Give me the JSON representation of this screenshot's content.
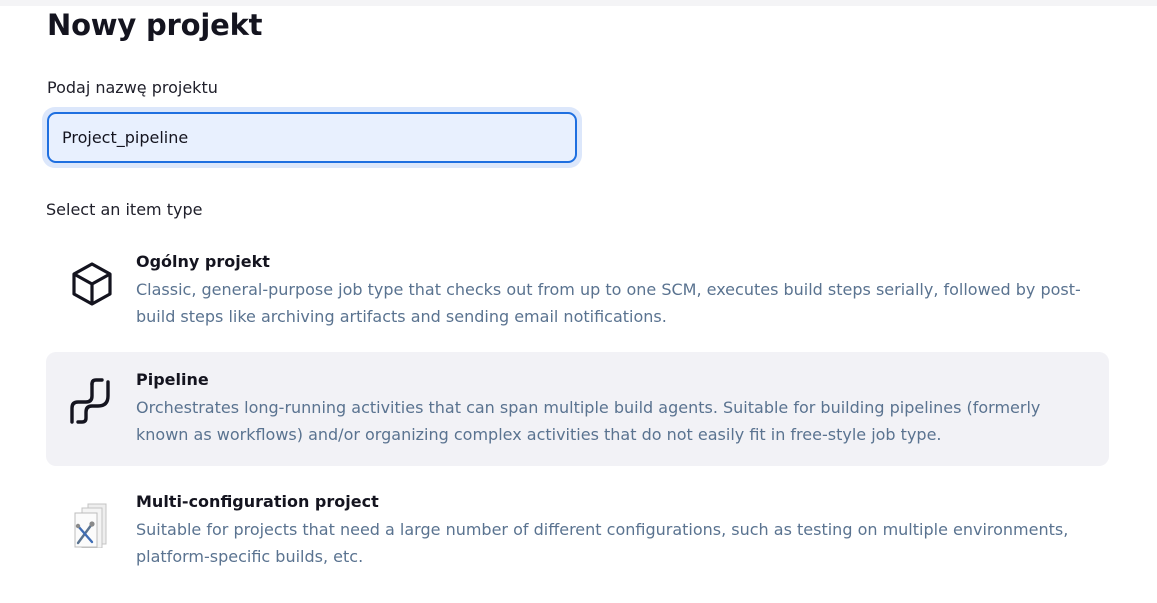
{
  "page": {
    "title": "Nowy projekt",
    "name_label": "Podaj nazwę projektu",
    "name_value": "Project_pipeline",
    "select_label": "Select an item type"
  },
  "item_types": [
    {
      "title": "Ogólny projekt",
      "description": "Classic, general-purpose job type that checks out from up to one SCM, executes build steps serially, followed by post-build steps like archiving artifacts and sending email notifications.",
      "icon": "cube-icon"
    },
    {
      "title": "Pipeline",
      "description": "Orchestrates long-running activities that can span multiple build agents. Suitable for building pipelines (formerly known as workflows) and/or organizing complex activities that do not easily fit in free-style job type.",
      "icon": "pipeline-icon",
      "selected": true
    },
    {
      "title": "Multi-configuration project",
      "description": "Suitable for projects that need a large number of different configurations, such as testing on multiple environments, platform-specific builds, etc.",
      "icon": "multi-config-icon"
    }
  ],
  "colors": {
    "accent": "#1e6fe0",
    "description_text": "#5a7390",
    "selected_background": "#f2f2f6"
  }
}
